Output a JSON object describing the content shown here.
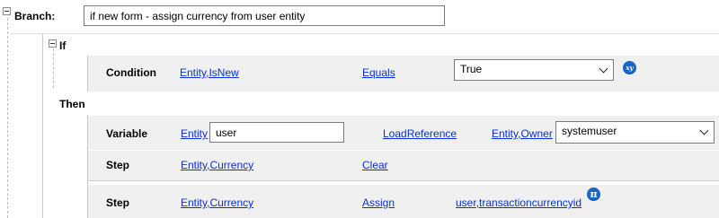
{
  "branch": {
    "label": "Branch:",
    "description": "if new form - assign currency from user entity"
  },
  "if_block": {
    "label": "If",
    "condition": {
      "label": "Condition",
      "field": {
        "entity": "Entity",
        "attribute": "IsNew"
      },
      "operator": "Equals",
      "value": "True",
      "icon": "xy-icon",
      "icon_text": "xy"
    }
  },
  "then_block": {
    "label": "Then",
    "rows": [
      {
        "label": "Variable",
        "entity_link": "Entity",
        "input_value": "user",
        "action": "LoadReference",
        "target": {
          "entity": "Entity",
          "attribute": "Owner"
        },
        "select_value": "systemuser"
      },
      {
        "label": "Step",
        "target": {
          "entity": "Entity",
          "attribute": "Currency"
        },
        "action": "Clear"
      },
      {
        "label": "Step",
        "target": {
          "entity": "Entity",
          "attribute": "Currency"
        },
        "action": "Assign",
        "source": {
          "entity": "user",
          "attribute": "transactioncurrencyid"
        },
        "icon": "pi-icon",
        "icon_text": "π"
      }
    ]
  },
  "colors": {
    "link": "#0b2fd6",
    "icon_blue": "#1667c7",
    "row_background": "#f0f0f0"
  }
}
